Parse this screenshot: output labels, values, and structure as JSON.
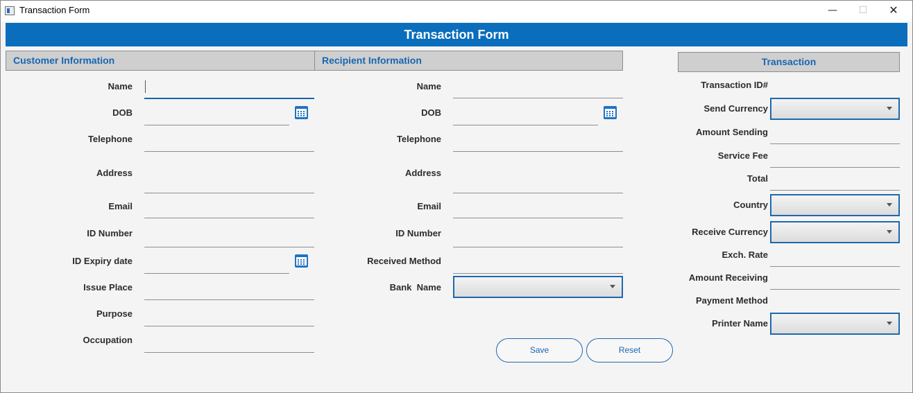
{
  "window": {
    "title": "Transaction Form",
    "minimize_glyph": "—",
    "maximize_glyph": "☐",
    "close_glyph": "✕"
  },
  "header": {
    "title": "Transaction Form"
  },
  "customer": {
    "heading": "Customer Information",
    "name": "Name",
    "dob": "DOB",
    "telephone": "Telephone",
    "address": "Address",
    "email": "Email",
    "id_number": "ID Number",
    "id_expiry": "ID Expiry date",
    "issue_place": "Issue Place",
    "purpose": "Purpose",
    "occupation": "Occupation"
  },
  "recipient": {
    "heading": "Recipient Information",
    "name": "Name",
    "dob": "DOB",
    "telephone": "Telephone",
    "address": "Address",
    "email": "Email",
    "id_number": "ID Number",
    "received_method": "Received Method",
    "bank_name": "Bank  Name"
  },
  "transaction": {
    "heading": "Transaction",
    "transaction_id": "Transaction ID#",
    "send_currency": "Send Currency",
    "amount_sending": "Amount Sending",
    "service_fee": "Service Fee",
    "total": "Total",
    "country": "Country",
    "receive_currency": "Receive Currency",
    "exch_rate": "Exch. Rate",
    "amount_receiving": "Amount Receiving",
    "payment_method": "Payment Method",
    "printer_name": "Printer Name"
  },
  "actions": {
    "save": "Save",
    "reset": "Reset"
  },
  "colors": {
    "accent": "#0a6ebd",
    "section_text": "#1766b1",
    "section_bg": "#cfcfcf",
    "window_bg": "#f4f4f4"
  },
  "icons": {
    "calendar": "calendar-icon",
    "dropdown": "chevron-down-icon"
  }
}
